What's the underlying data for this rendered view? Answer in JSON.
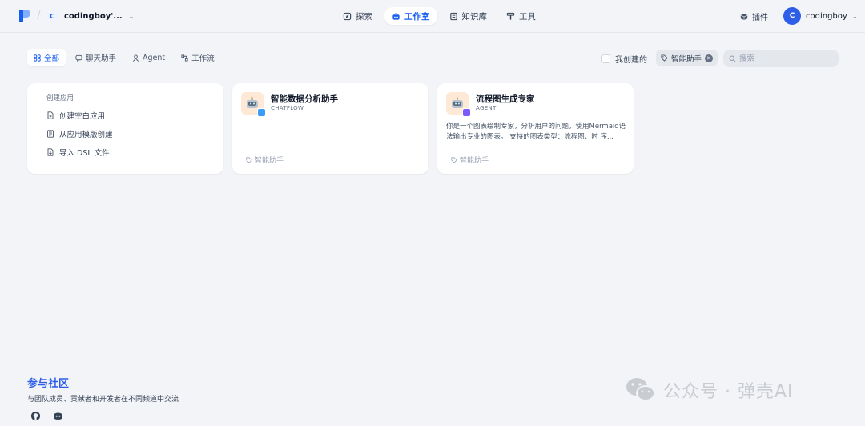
{
  "header": {
    "workspace_initial": "C",
    "workspace_name": "codingboy'...",
    "nav": [
      {
        "label": "探索"
      },
      {
        "label": "工作室"
      },
      {
        "label": "知识库"
      },
      {
        "label": "工具"
      }
    ],
    "plugins_label": "插件",
    "user_initial": "C",
    "user_name": "codingboy"
  },
  "filters": {
    "tabs": [
      {
        "label": "全部"
      },
      {
        "label": "聊天助手"
      },
      {
        "label": "Agent"
      },
      {
        "label": "工作流"
      }
    ],
    "mine_label": "我创建的",
    "tag_label": "智能助手",
    "search_placeholder": "搜索"
  },
  "create_card": {
    "title": "创建应用",
    "items": [
      {
        "label": "创建空白应用"
      },
      {
        "label": "从应用模版创建"
      },
      {
        "label": "导入 DSL 文件"
      }
    ]
  },
  "apps": [
    {
      "name": "智能数据分析助手",
      "type": "CHATFLOW",
      "description": "",
      "tag": "智能助手"
    },
    {
      "name": "流程图生成专家",
      "type": "AGENT",
      "description": "你是一个图表绘制专家，分析用户的问题，使用Mermaid语法输出专业的图表。 支持的图表类型：流程图、时 序...",
      "tag": "智能助手"
    }
  ],
  "community": {
    "title": "参与社区",
    "subtitle": "与团队成员、贡献者和开发者在不同频道中交流"
  },
  "watermark": "公众号 · 弹壳AI",
  "colors": {
    "accent": "#155eef",
    "avatar": "#2e5ee8",
    "chatflow_badge": "#3b9cf6",
    "agent_badge": "#7a5af8"
  }
}
